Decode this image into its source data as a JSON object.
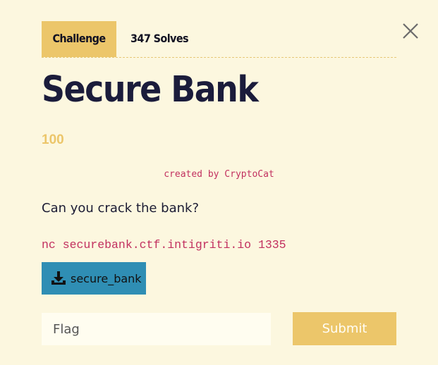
{
  "modal": {
    "close_icon": "close-icon",
    "tabs": [
      {
        "label": "Challenge",
        "active": true
      },
      {
        "label": "347 Solves",
        "active": false
      }
    ],
    "title": "Secure Bank",
    "points": "100",
    "author": "created by CryptoCat",
    "description": "Can you crack the bank?",
    "connection": "nc securebank.ctf.intigriti.io 1335",
    "file": {
      "icon": "download-icon",
      "label": "secure_bank"
    },
    "flag_input": {
      "placeholder": "Flag",
      "value": ""
    },
    "submit_label": "Submit"
  },
  "colors": {
    "background": "#fcf7df",
    "accent": "#ecc66a",
    "title": "#1b1c3b",
    "code": "#c2305f",
    "file_button": "#2f8eb4"
  }
}
